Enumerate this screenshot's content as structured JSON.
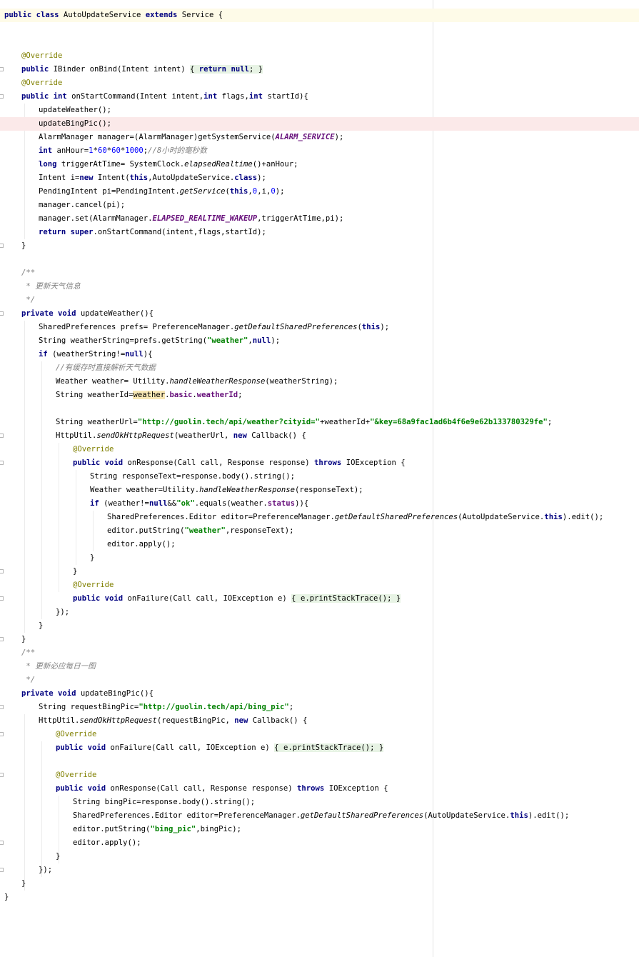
{
  "editor": {
    "lines": [
      {
        "hl": "yellow",
        "indent": 0,
        "tokens": [
          {
            "t": "public class",
            "c": "kw"
          },
          {
            "t": " AutoUpdateService ",
            "c": "pl"
          },
          {
            "t": "extends",
            "c": "kw"
          },
          {
            "t": " Service {",
            "c": "pl"
          }
        ]
      },
      {
        "indent": 0,
        "tokens": []
      },
      {
        "indent": 0,
        "tokens": []
      },
      {
        "indent": 1,
        "tokens": [
          {
            "t": "@Override",
            "c": "an"
          }
        ]
      },
      {
        "indent": 1,
        "tokens": [
          {
            "t": "public",
            "c": "kw"
          },
          {
            "t": " IBinder onBind(Intent intent) ",
            "c": "pl"
          },
          {
            "t": "{ ",
            "c": "pl",
            "b": "br"
          },
          {
            "t": "return",
            "c": "kw",
            "b": "br"
          },
          {
            "t": " ",
            "c": "pl",
            "b": "br"
          },
          {
            "t": "null",
            "c": "kw",
            "b": "br"
          },
          {
            "t": "; }",
            "c": "pl",
            "b": "br"
          }
        ]
      },
      {
        "indent": 1,
        "tokens": [
          {
            "t": "@Override",
            "c": "an"
          }
        ]
      },
      {
        "indent": 1,
        "tokens": [
          {
            "t": "public int",
            "c": "kw"
          },
          {
            "t": " onStartCommand(Intent intent,",
            "c": "pl"
          },
          {
            "t": "int",
            "c": "kw"
          },
          {
            "t": " flags,",
            "c": "pl"
          },
          {
            "t": "int",
            "c": "kw"
          },
          {
            "t": " startId){",
            "c": "pl"
          }
        ]
      },
      {
        "indent": 2,
        "tokens": [
          {
            "t": "updateWeather();",
            "c": "pl"
          }
        ]
      },
      {
        "hl": "pink",
        "indent": 2,
        "tokens": [
          {
            "t": "updateBingPic();",
            "c": "pl"
          }
        ]
      },
      {
        "indent": 2,
        "tokens": [
          {
            "t": "AlarmManager manager=(AlarmManager)getSystemService(",
            "c": "pl"
          },
          {
            "t": "ALARM_SERVICE",
            "c": "fi"
          },
          {
            "t": ");",
            "c": "pl"
          }
        ]
      },
      {
        "indent": 2,
        "tokens": [
          {
            "t": "int",
            "c": "kw"
          },
          {
            "t": " anHour=",
            "c": "pl"
          },
          {
            "t": "1",
            "c": "nu"
          },
          {
            "t": "*",
            "c": "pl"
          },
          {
            "t": "60",
            "c": "nu"
          },
          {
            "t": "*",
            "c": "pl"
          },
          {
            "t": "60",
            "c": "nu"
          },
          {
            "t": "*",
            "c": "pl"
          },
          {
            "t": "1000",
            "c": "nu"
          },
          {
            "t": ";",
            "c": "pl"
          },
          {
            "t": "//8小时的毫秒数",
            "c": "cm"
          }
        ]
      },
      {
        "indent": 2,
        "tokens": [
          {
            "t": "long",
            "c": "kw"
          },
          {
            "t": " triggerAtTime= SystemClock.",
            "c": "pl"
          },
          {
            "t": "elapsedRealtime",
            "c": "sm"
          },
          {
            "t": "()+anHour;",
            "c": "pl"
          }
        ]
      },
      {
        "indent": 2,
        "tokens": [
          {
            "t": "Intent i=",
            "c": "pl"
          },
          {
            "t": "new",
            "c": "kw"
          },
          {
            "t": " Intent(",
            "c": "pl"
          },
          {
            "t": "this",
            "c": "kw"
          },
          {
            "t": ",AutoUpdateService.",
            "c": "pl"
          },
          {
            "t": "class",
            "c": "kw"
          },
          {
            "t": ");",
            "c": "pl"
          }
        ]
      },
      {
        "indent": 2,
        "tokens": [
          {
            "t": "PendingIntent pi=PendingIntent.",
            "c": "pl"
          },
          {
            "t": "getService",
            "c": "sm"
          },
          {
            "t": "(",
            "c": "pl"
          },
          {
            "t": "this",
            "c": "kw"
          },
          {
            "t": ",",
            "c": "pl"
          },
          {
            "t": "0",
            "c": "nu"
          },
          {
            "t": ",i,",
            "c": "pl"
          },
          {
            "t": "0",
            "c": "nu"
          },
          {
            "t": ");",
            "c": "pl"
          }
        ]
      },
      {
        "indent": 2,
        "tokens": [
          {
            "t": "manager.cancel(pi);",
            "c": "pl"
          }
        ]
      },
      {
        "indent": 2,
        "tokens": [
          {
            "t": "manager.set(AlarmManager.",
            "c": "pl"
          },
          {
            "t": "ELAPSED_REALTIME_WAKEUP",
            "c": "fi"
          },
          {
            "t": ",triggerAtTime,pi);",
            "c": "pl"
          }
        ]
      },
      {
        "indent": 2,
        "tokens": [
          {
            "t": "return super",
            "c": "kw"
          },
          {
            "t": ".onStartCommand(intent,flags,startId);",
            "c": "pl"
          }
        ]
      },
      {
        "indent": 1,
        "tokens": [
          {
            "t": "}",
            "c": "pl"
          }
        ]
      },
      {
        "indent": 0,
        "tokens": []
      },
      {
        "indent": 1,
        "tokens": [
          {
            "t": "/**",
            "c": "cm"
          }
        ]
      },
      {
        "indent": 1,
        "tokens": [
          {
            "t": " * 更新天气信息",
            "c": "cm"
          }
        ]
      },
      {
        "indent": 1,
        "tokens": [
          {
            "t": " */",
            "c": "cm"
          }
        ]
      },
      {
        "indent": 1,
        "tokens": [
          {
            "t": "private void",
            "c": "kw"
          },
          {
            "t": " updateWeather(){",
            "c": "pl"
          }
        ]
      },
      {
        "indent": 2,
        "tokens": [
          {
            "t": "SharedPreferences prefs= PreferenceManager.",
            "c": "pl"
          },
          {
            "t": "getDefaultSharedPreferences",
            "c": "sm"
          },
          {
            "t": "(",
            "c": "pl"
          },
          {
            "t": "this",
            "c": "kw"
          },
          {
            "t": ");",
            "c": "pl"
          }
        ]
      },
      {
        "indent": 2,
        "tokens": [
          {
            "t": "String weatherString=prefs.getString(",
            "c": "pl"
          },
          {
            "t": "\"weather\"",
            "c": "st"
          },
          {
            "t": ",",
            "c": "pl"
          },
          {
            "t": "null",
            "c": "kw"
          },
          {
            "t": ");",
            "c": "pl"
          }
        ]
      },
      {
        "indent": 2,
        "tokens": [
          {
            "t": "if",
            "c": "kw"
          },
          {
            "t": " (weatherString!=",
            "c": "pl"
          },
          {
            "t": "null",
            "c": "kw"
          },
          {
            "t": "){",
            "c": "pl"
          }
        ]
      },
      {
        "indent": 3,
        "tokens": [
          {
            "t": "//有缓存时直接解析天气数据",
            "c": "cm"
          }
        ]
      },
      {
        "indent": 3,
        "tokens": [
          {
            "t": "Weather weather= Utility.",
            "c": "pl"
          },
          {
            "t": "handleWeatherResponse",
            "c": "sm"
          },
          {
            "t": "(weatherString);",
            "c": "pl"
          }
        ]
      },
      {
        "indent": 3,
        "tokens": [
          {
            "t": "String weatherId=",
            "c": "pl"
          },
          {
            "t": "weather",
            "c": "pl",
            "b": "hl"
          },
          {
            "t": ".",
            "c": "pl"
          },
          {
            "t": "basic",
            "c": "pr"
          },
          {
            "t": ".",
            "c": "pl"
          },
          {
            "t": "weatherId",
            "c": "pr"
          },
          {
            "t": ";",
            "c": "pl"
          }
        ]
      },
      {
        "indent": 0,
        "tokens": []
      },
      {
        "indent": 3,
        "tokens": [
          {
            "t": "String weatherUrl=",
            "c": "pl"
          },
          {
            "t": "\"http://guolin.tech/api/weather?cityid=\"",
            "c": "st"
          },
          {
            "t": "+weatherId+",
            "c": "pl"
          },
          {
            "t": "\"&key=68a9fac1ad6b4f6e9e62b133780329fe\"",
            "c": "st"
          },
          {
            "t": ";",
            "c": "pl"
          }
        ]
      },
      {
        "indent": 3,
        "tokens": [
          {
            "t": "HttpUtil.",
            "c": "pl"
          },
          {
            "t": "sendOkHttpRequest",
            "c": "sm"
          },
          {
            "t": "(weatherUrl, ",
            "c": "pl"
          },
          {
            "t": "new",
            "c": "kw"
          },
          {
            "t": " Callback() {",
            "c": "pl"
          }
        ]
      },
      {
        "indent": 4,
        "tokens": [
          {
            "t": "@Override",
            "c": "an"
          }
        ]
      },
      {
        "indent": 4,
        "tokens": [
          {
            "t": "public void",
            "c": "kw"
          },
          {
            "t": " onResponse(Call call, Response response) ",
            "c": "pl"
          },
          {
            "t": "throws",
            "c": "kw"
          },
          {
            "t": " IOException {",
            "c": "pl"
          }
        ]
      },
      {
        "indent": 5,
        "tokens": [
          {
            "t": "String responseText=response.body().string();",
            "c": "pl"
          }
        ]
      },
      {
        "indent": 5,
        "tokens": [
          {
            "t": "Weather weather=Utility.",
            "c": "pl"
          },
          {
            "t": "handleWeatherResponse",
            "c": "sm"
          },
          {
            "t": "(responseText);",
            "c": "pl"
          }
        ]
      },
      {
        "indent": 5,
        "tokens": [
          {
            "t": "if",
            "c": "kw"
          },
          {
            "t": " (weather!=",
            "c": "pl"
          },
          {
            "t": "null",
            "c": "kw"
          },
          {
            "t": "&&",
            "c": "pl"
          },
          {
            "t": "\"ok\"",
            "c": "st"
          },
          {
            "t": ".equals(weather.",
            "c": "pl"
          },
          {
            "t": "status",
            "c": "pr"
          },
          {
            "t": ")){",
            "c": "pl"
          }
        ]
      },
      {
        "indent": 6,
        "tokens": [
          {
            "t": "SharedPreferences.Editor editor=PreferenceManager.",
            "c": "pl"
          },
          {
            "t": "getDefaultSharedPreferences",
            "c": "sm"
          },
          {
            "t": "(AutoUpdateService.",
            "c": "pl"
          },
          {
            "t": "this",
            "c": "kw"
          },
          {
            "t": ").edit();",
            "c": "pl"
          }
        ]
      },
      {
        "indent": 6,
        "tokens": [
          {
            "t": "editor.putString(",
            "c": "pl"
          },
          {
            "t": "\"weather\"",
            "c": "st"
          },
          {
            "t": ",responseText);",
            "c": "pl"
          }
        ]
      },
      {
        "indent": 6,
        "tokens": [
          {
            "t": "editor.apply();",
            "c": "pl"
          }
        ]
      },
      {
        "indent": 5,
        "tokens": [
          {
            "t": "}",
            "c": "pl"
          }
        ]
      },
      {
        "indent": 4,
        "tokens": [
          {
            "t": "}",
            "c": "pl"
          }
        ]
      },
      {
        "indent": 4,
        "tokens": [
          {
            "t": "@Override",
            "c": "an"
          }
        ]
      },
      {
        "indent": 4,
        "tokens": [
          {
            "t": "public void",
            "c": "kw"
          },
          {
            "t": " onFailure(Call call, IOException e) ",
            "c": "pl"
          },
          {
            "t": "{ ",
            "c": "pl",
            "b": "br"
          },
          {
            "t": "e.printStackTrace(); }",
            "c": "pl",
            "b": "br"
          }
        ]
      },
      {
        "indent": 3,
        "tokens": [
          {
            "t": "});",
            "c": "pl"
          }
        ]
      },
      {
        "indent": 2,
        "tokens": [
          {
            "t": "}",
            "c": "pl"
          }
        ]
      },
      {
        "indent": 1,
        "tokens": [
          {
            "t": "}",
            "c": "pl"
          }
        ]
      },
      {
        "indent": 1,
        "tokens": [
          {
            "t": "/**",
            "c": "cm"
          }
        ]
      },
      {
        "indent": 1,
        "tokens": [
          {
            "t": " * 更新必应每日一图",
            "c": "cm"
          }
        ]
      },
      {
        "indent": 1,
        "tokens": [
          {
            "t": " */",
            "c": "cm"
          }
        ]
      },
      {
        "indent": 1,
        "tokens": [
          {
            "t": "private void",
            "c": "kw"
          },
          {
            "t": " updateBingPic(){",
            "c": "pl"
          }
        ]
      },
      {
        "indent": 2,
        "tokens": [
          {
            "t": "String requestBingPic=",
            "c": "pl"
          },
          {
            "t": "\"http://guolin.tech/api/bing_pic\"",
            "c": "st"
          },
          {
            "t": ";",
            "c": "pl"
          }
        ]
      },
      {
        "indent": 2,
        "tokens": [
          {
            "t": "HttpUtil.",
            "c": "pl"
          },
          {
            "t": "sendOkHttpRequest",
            "c": "sm"
          },
          {
            "t": "(requestBingPic, ",
            "c": "pl"
          },
          {
            "t": "new",
            "c": "kw"
          },
          {
            "t": " Callback() {",
            "c": "pl"
          }
        ]
      },
      {
        "indent": 3,
        "tokens": [
          {
            "t": "@Override",
            "c": "an"
          }
        ]
      },
      {
        "indent": 3,
        "tokens": [
          {
            "t": "public void",
            "c": "kw"
          },
          {
            "t": " onFailure(Call call, IOException e) ",
            "c": "pl"
          },
          {
            "t": "{ ",
            "c": "pl",
            "b": "br"
          },
          {
            "t": "e.printStackTrace(); }",
            "c": "pl",
            "b": "br"
          }
        ]
      },
      {
        "indent": 0,
        "tokens": []
      },
      {
        "indent": 3,
        "tokens": [
          {
            "t": "@Override",
            "c": "an"
          }
        ]
      },
      {
        "indent": 3,
        "tokens": [
          {
            "t": "public void",
            "c": "kw"
          },
          {
            "t": " onResponse(Call call, Response response) ",
            "c": "pl"
          },
          {
            "t": "throws",
            "c": "kw"
          },
          {
            "t": " IOException {",
            "c": "pl"
          }
        ]
      },
      {
        "indent": 4,
        "tokens": [
          {
            "t": "String bingPic=response.body().string();",
            "c": "pl"
          }
        ]
      },
      {
        "indent": 4,
        "tokens": [
          {
            "t": "SharedPreferences.Editor editor=PreferenceManager.",
            "c": "pl"
          },
          {
            "t": "getDefaultSharedPreferences",
            "c": "sm"
          },
          {
            "t": "(AutoUpdateService.",
            "c": "pl"
          },
          {
            "t": "this",
            "c": "kw"
          },
          {
            "t": ").edit();",
            "c": "pl"
          }
        ]
      },
      {
        "indent": 4,
        "tokens": [
          {
            "t": "editor.putString(",
            "c": "pl"
          },
          {
            "t": "\"bing_pic\"",
            "c": "st"
          },
          {
            "t": ",bingPic);",
            "c": "pl"
          }
        ]
      },
      {
        "indent": 4,
        "tokens": [
          {
            "t": "editor.apply();",
            "c": "pl"
          }
        ]
      },
      {
        "indent": 3,
        "tokens": [
          {
            "t": "}",
            "c": "pl"
          }
        ]
      },
      {
        "indent": 2,
        "tokens": [
          {
            "t": "});",
            "c": "pl"
          }
        ]
      },
      {
        "indent": 1,
        "tokens": [
          {
            "t": "}",
            "c": "pl"
          }
        ]
      },
      {
        "indent": 0,
        "tokens": [
          {
            "t": "}",
            "c": "pl"
          }
        ]
      }
    ],
    "fold_markers": [
      4,
      6,
      17,
      22,
      31,
      33,
      41,
      43,
      46,
      51,
      53,
      56,
      61,
      63
    ]
  }
}
